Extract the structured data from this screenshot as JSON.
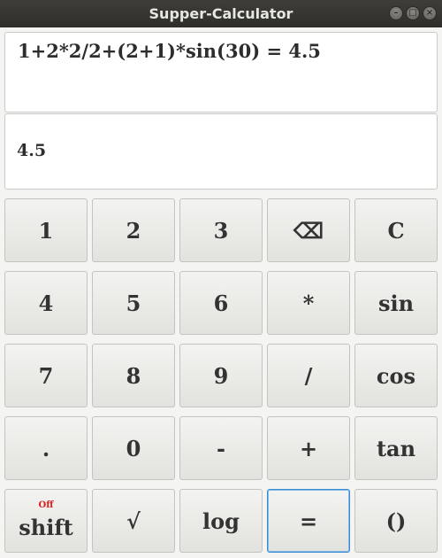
{
  "window": {
    "title": "Supper-Calculator",
    "controls": {
      "minimize": "–",
      "maximize": "□",
      "close": "×"
    }
  },
  "display": {
    "expression": "1+2*2/2+(2+1)*sin(30) = 4.5",
    "result": "4.5"
  },
  "keys": {
    "k1": "1",
    "k2": "2",
    "k3": "3",
    "backspace": "⌫",
    "clear": "C",
    "k4": "4",
    "k5": "5",
    "k6": "6",
    "multiply": "*",
    "sin": "sin",
    "k7": "7",
    "k8": "8",
    "k9": "9",
    "divide": "/",
    "cos": "cos",
    "dot": ".",
    "k0": "0",
    "minus": "-",
    "plus": "+",
    "tan": "tan",
    "shift": "shift",
    "shift_state": "Off",
    "sqrt": "√",
    "log": "log",
    "equals": "=",
    "parens": "()"
  },
  "colors": {
    "shift_state": "#e01b1b",
    "focus": "#3a8ed3",
    "titlebar": "#3e3d39"
  }
}
